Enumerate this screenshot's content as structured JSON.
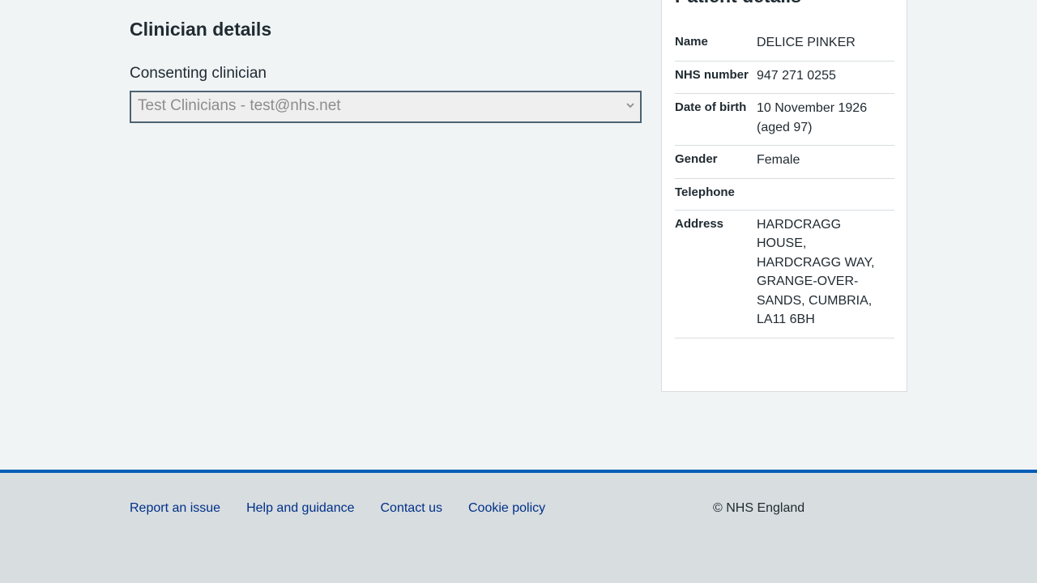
{
  "clinician": {
    "heading": "Clinician details",
    "select_label": "Consenting clinician",
    "select_value": "Test Clinicians - test@nhs.net"
  },
  "patient": {
    "heading": "Patient details",
    "rows": [
      {
        "key": "Name",
        "value": "DELICE PINKER"
      },
      {
        "key": "NHS number",
        "value": "947 271 0255"
      },
      {
        "key": "Date of birth",
        "value": "10 November 1926 (aged 97)"
      },
      {
        "key": "Gender",
        "value": "Female"
      },
      {
        "key": "Telephone",
        "value": ""
      },
      {
        "key": "Address",
        "value": "HARDCRAGG HOUSE, HARDCRAGG WAY, GRANGE-OVER-SANDS, CUMBRIA, LA11 6BH"
      }
    ]
  },
  "footer": {
    "links": [
      "Report an issue",
      "Help and guidance",
      "Contact us",
      "Cookie policy"
    ],
    "copyright": "© NHS England"
  },
  "colors": {
    "page_bg": "#f0f4f5",
    "footer_bg": "#d8dde0",
    "footer_border": "#005eb8",
    "link": "#003087",
    "text": "#212b32"
  }
}
